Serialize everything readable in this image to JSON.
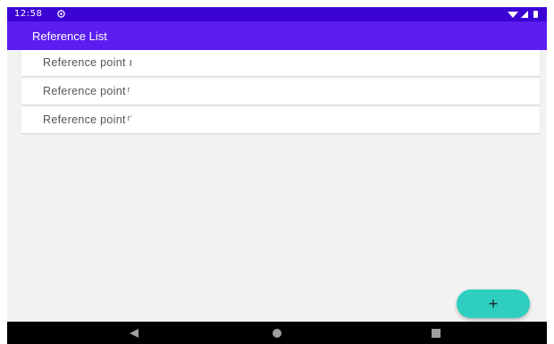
{
  "status_bar": {
    "time": "12:58"
  },
  "app_bar": {
    "title": "Reference List"
  },
  "list": {
    "items": [
      {
        "label": "Reference point ı"
      },
      {
        "label": "Reference point ͬ"
      },
      {
        "label": "Reference point ͬ͘"
      }
    ]
  },
  "fab": {
    "label": "+"
  },
  "colors": {
    "status_bar": "#3b04d4",
    "app_bar": "#5b1df0",
    "fab": "#2ecfc0",
    "nav_bar": "#000000"
  },
  "icons": {
    "status_notif": "notification-icon",
    "wifi": "wifi-icon",
    "signal": "signal-icon",
    "battery": "battery-icon",
    "back": "back-icon",
    "home": "home-icon",
    "recents": "recents-icon"
  }
}
